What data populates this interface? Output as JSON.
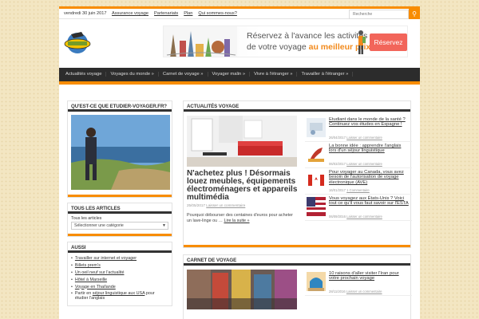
{
  "topbar": {
    "date": "vendredi 30 juin 2017",
    "nav": [
      "Assurance voyage",
      "Partenariats",
      "Plan",
      "Qui sommes-nous?"
    ],
    "search_placeholder": "Recherche"
  },
  "banner": {
    "line1": "Réservez à l'avance les activités",
    "line2_a": "de votre voyage ",
    "line2_b": "au meilleur prix !",
    "button": "Réservez"
  },
  "mainnav": [
    "Actualités voyage",
    "Voyages du monde »",
    "Carnet de voyage »",
    "Voyager malin »",
    "Vivre à l'étranger »",
    "Travailler à l'étranger »"
  ],
  "sidebar": {
    "about_title": "QU'EST-CE QUE ETUDIER-VOYAGER.FR?",
    "tous_title": "TOUS LES ARTICLES",
    "tous_label": "Tous les articles",
    "select_value": "Sélectionner une catégorie",
    "aussi_title": "AUSSI",
    "links": [
      "Travailler sur internet et voyager",
      "Billets prem's",
      "Un oeil neuf sur l'actualité",
      "Hôtel à Marseille",
      "Voyage en Thaïlande"
    ],
    "last_link_pre": "Partir en ",
    "last_link": "séjour linguistique aux USA",
    "last_link_post": " pour",
    "last_link_line2": "étudier l'anglais"
  },
  "section1": {
    "title": "ACTUALITÉS VOYAGE",
    "feature": {
      "title": "N'achetez plus ! Désormais louez meubles, équipements électroménagers et appareils multimédia",
      "date": "25/05/2017",
      "comment": "Laisser un commentaire",
      "excerpt": "Pourquoi débourser des centaines d'euros pour acheter un lave-linge ou … ",
      "more": "Lire la suite »"
    },
    "items": [
      {
        "title": "Etudiant dans le monde de la santé ? Continuez vos études en Espagne !",
        "date": "26/04/2017",
        "comment": "Laisser un commentaire"
      },
      {
        "title": "La bonne idée : apprendre l'anglais lors d'un séjour linguistique",
        "date": "06/03/2017",
        "comment": "Laisser un commentaire"
      },
      {
        "title": "Pour voyager au Canada, vous avez besoin de l'autorisation de voyage électronique (AVE)",
        "date": "16/01/2017",
        "comment": "1 Commentaire"
      },
      {
        "title": "Vous voyagez aux États-Unis ? Voici tout ce qu'il vous faut savoir sur l'ESTA",
        "date": "06/09/2016",
        "comment": "Laisser un commentaire"
      }
    ]
  },
  "section2": {
    "title": "CARNET DE VOYAGE",
    "items": [
      {
        "title": "10 raisons d'aller visiter l'Iran pour votre prochain voyage",
        "date": "28/11/2016",
        "comment": "Laisser un commentaire"
      }
    ]
  }
}
